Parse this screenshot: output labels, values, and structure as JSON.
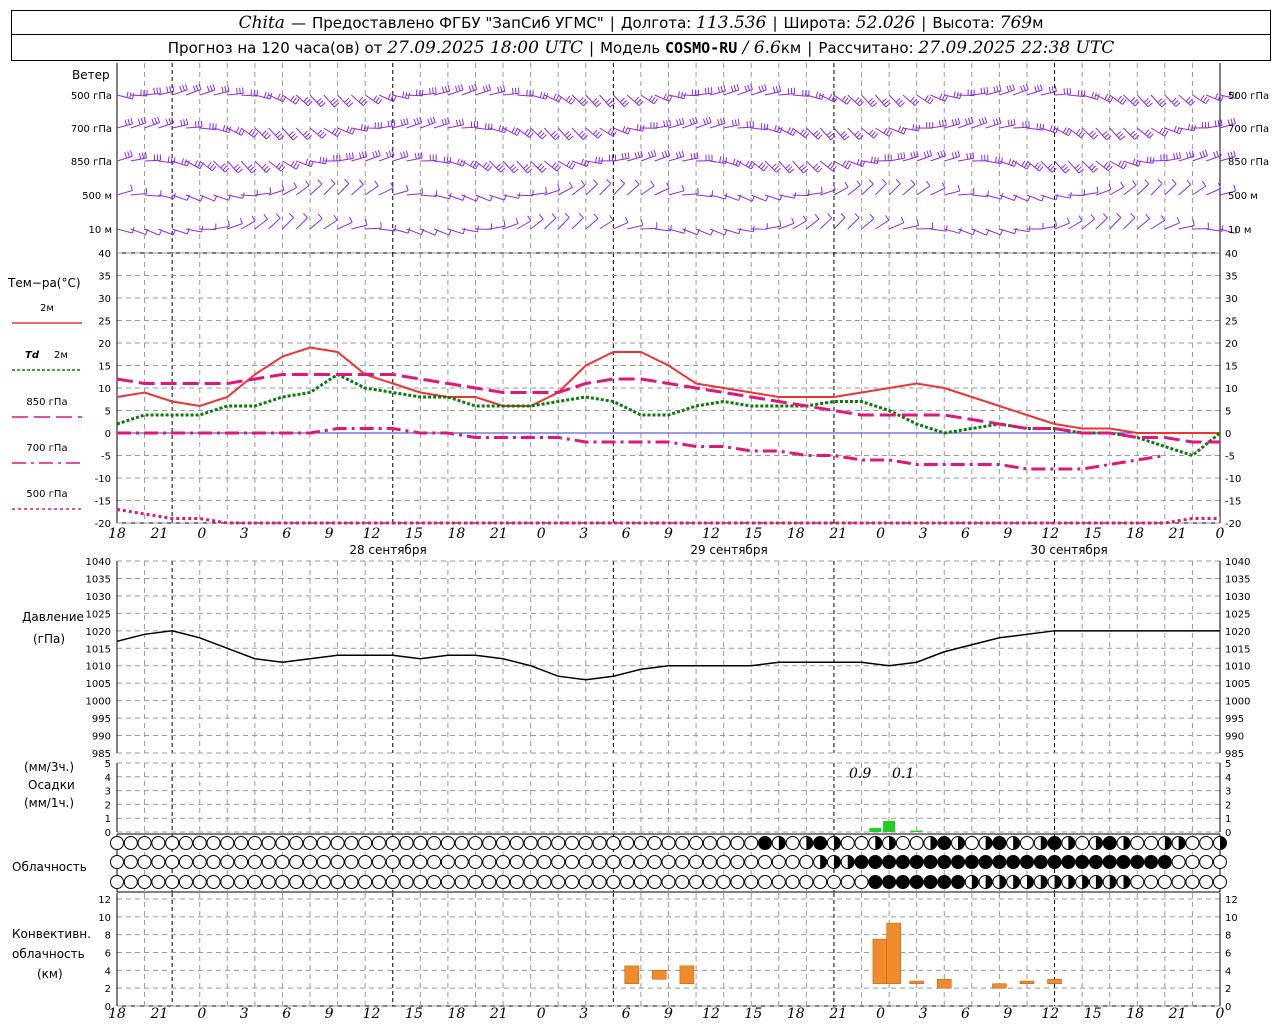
{
  "header": {
    "line1": {
      "station": "Chita",
      "dash": "—",
      "provider": "Предоставлено ФГБУ \"ЗапСиб УГМС\"",
      "lon_label": "Долгота:",
      "lon_value": "113.536",
      "lat_label": "Широта:",
      "lat_value": "52.026",
      "alt_label": "Высота:",
      "alt_value": "769",
      "alt_unit": "м"
    },
    "line2": {
      "forecast_label": "Прогноз на 120 часа(ов) от",
      "forecast_time": "27.09.2025 18:00 UTC",
      "model_label": "Модель",
      "model_name": "COSMO-RU",
      "model_res": "6.6",
      "model_res_unit": "км",
      "calc_label": "Рассчитано:",
      "calc_time": "27.09.2025 22:38 UTC"
    }
  },
  "colors": {
    "wind": "#8a2be2",
    "t2m": "#ee3333",
    "td2m": "#0a7a0a",
    "t850": "#e0167a",
    "t700": "#e0167a",
    "t500": "#e0167a",
    "pressure": "#000000",
    "precip": "#22cc22",
    "convective": "#f08a2a",
    "grid": "#999999"
  },
  "wind_panel": {
    "title": "Ветер",
    "levels": [
      "500 гПа",
      "700 гПа",
      "850 гПа",
      "500 м",
      "10   м"
    ],
    "levels_right": [
      "500 гПа",
      "700 гПа",
      "850 гПа",
      "500 м",
      "10   м"
    ]
  },
  "temp_panel": {
    "title": "Тем−ра(°С)",
    "legend": [
      {
        "label": "2м",
        "key": "t2m"
      },
      {
        "label_td": "Td",
        "label": "2м",
        "key": "td2m"
      },
      {
        "label": "850 гПа",
        "key": "t850"
      },
      {
        "label": "700 гПа",
        "key": "t700"
      },
      {
        "label": "500 гПа",
        "key": "t500"
      }
    ]
  },
  "pressure_panel": {
    "title1": "Давление",
    "title2": "(гПа)"
  },
  "precip_panel": {
    "title_top": "(мм/3ч.)",
    "title_mid": "Осадки",
    "title_bot": "(мм/1ч.)",
    "annotations": [
      "0.9",
      "0.1"
    ]
  },
  "cloud_panel": {
    "title": "Облачность"
  },
  "conv_panel": {
    "title1": "Конвективн.",
    "title2": "облачность",
    "title3": "(км)"
  },
  "x_axis": {
    "hour_labels": [
      "18",
      "21",
      "0",
      "3",
      "6",
      "9",
      "12",
      "15",
      "18",
      "21",
      "0",
      "3",
      "6",
      "9",
      "12",
      "15",
      "18",
      "21",
      "0",
      "3",
      "6",
      "9",
      "12",
      "15",
      "18",
      "21",
      "0"
    ],
    "day_labels": [
      "28 сентября",
      "29 сентября",
      "30 сентября"
    ]
  },
  "chart_data": [
    {
      "type": "line",
      "panel": "temperature",
      "ylim": [
        -20,
        40
      ],
      "yticks": [
        "40",
        "35",
        "30",
        "25",
        "20",
        "15",
        "10",
        "5",
        "0",
        "-5",
        "-10",
        "-15",
        "-20"
      ],
      "x_hours": [
        0,
        3,
        6,
        9,
        12,
        15,
        18,
        21,
        24,
        27,
        30,
        33,
        36,
        39,
        42,
        45,
        48,
        51,
        54,
        57,
        60,
        63,
        66,
        69,
        72,
        75,
        78,
        81,
        84,
        87,
        90,
        93,
        96,
        99,
        102,
        105,
        108,
        111,
        114,
        117,
        120
      ],
      "series": [
        {
          "name": "2м",
          "key": "t2m",
          "values": [
            8,
            9,
            7,
            6,
            8,
            13,
            17,
            19,
            18,
            13,
            11,
            9,
            8,
            8,
            6,
            6,
            9,
            15,
            18,
            18,
            15,
            11,
            10,
            9,
            8,
            8,
            8,
            9,
            10,
            11,
            10,
            8,
            6,
            4,
            2,
            1,
            1,
            0,
            0,
            0,
            0
          ]
        },
        {
          "name": "Td 2м",
          "key": "td2m",
          "values": [
            2,
            4,
            4,
            4,
            6,
            6,
            8,
            9,
            13,
            10,
            9,
            8,
            8,
            6,
            6,
            6,
            7,
            8,
            7,
            4,
            4,
            6,
            7,
            6,
            6,
            6,
            7,
            7,
            5,
            2,
            0,
            1,
            2,
            1,
            1,
            0,
            0,
            -1,
            -3,
            -5,
            0
          ]
        },
        {
          "name": "850 гПа",
          "key": "t850",
          "values": [
            12,
            11,
            11,
            11,
            11,
            12,
            13,
            13,
            13,
            13,
            13,
            12,
            11,
            10,
            9,
            9,
            9,
            11,
            12,
            12,
            11,
            10,
            9,
            8,
            7,
            6,
            5,
            4,
            4,
            4,
            4,
            3,
            2,
            1,
            1,
            0,
            0,
            -1,
            -1,
            -2,
            -2
          ]
        },
        {
          "name": "700 гПа",
          "key": "t700",
          "values": [
            0,
            0,
            0,
            0,
            0,
            0,
            0,
            0,
            1,
            1,
            1,
            0,
            0,
            -1,
            -1,
            -1,
            -1,
            -2,
            -2,
            -2,
            -2,
            -3,
            -3,
            -4,
            -4,
            -5,
            -5,
            -6,
            -6,
            -7,
            -7,
            -7,
            -7,
            -8,
            -8,
            -8,
            -7,
            -6,
            -5
          ]
        },
        {
          "name": "500 гПа",
          "key": "t500",
          "values": [
            -17,
            -18,
            -19,
            -19,
            -20,
            -20,
            -20,
            -20,
            -20,
            -20,
            -20,
            -20,
            -20,
            -20,
            -20,
            -20,
            -20,
            -20,
            -20,
            -20,
            -20,
            -20,
            -20,
            -20,
            -20,
            -20,
            -20,
            -20,
            -20,
            -20,
            -20,
            -20,
            -20,
            -20,
            -20,
            -20,
            -20,
            -20,
            -20,
            -19,
            -19
          ]
        }
      ]
    },
    {
      "type": "line",
      "panel": "pressure",
      "ylim": [
        985,
        1040
      ],
      "yticks": [
        "1040",
        "1035",
        "1030",
        "1025",
        "1020",
        "1015",
        "1010",
        "1005",
        "1000",
        "995",
        "990",
        "985"
      ],
      "x_hours": [
        0,
        3,
        6,
        9,
        12,
        15,
        18,
        21,
        24,
        27,
        30,
        33,
        36,
        39,
        42,
        45,
        48,
        51,
        54,
        57,
        60,
        63,
        66,
        69,
        72,
        75,
        78,
        81,
        84,
        87,
        90,
        93,
        96,
        99,
        102,
        105,
        108,
        111,
        114,
        117,
        120
      ],
      "series": [
        {
          "name": "Давление",
          "key": "pressure",
          "values": [
            1017,
            1019,
            1020,
            1018,
            1015,
            1012,
            1011,
            1012,
            1013,
            1013,
            1013,
            1012,
            1013,
            1013,
            1012,
            1010,
            1007,
            1006,
            1007,
            1009,
            1010,
            1010,
            1010,
            1010,
            1011,
            1011,
            1011,
            1011,
            1010,
            1011,
            1014,
            1016,
            1018,
            1019,
            1020,
            1020,
            1020,
            1020,
            1020,
            1020,
            1020
          ]
        }
      ]
    },
    {
      "type": "bar",
      "panel": "precipitation",
      "ylim": [
        0,
        5
      ],
      "yticks": [
        "5",
        "4",
        "3",
        "2",
        "1",
        "0"
      ],
      "bars": [
        {
          "x_hour": 82.5,
          "value": 0.3
        },
        {
          "x_hour": 84,
          "value": 0.8
        },
        {
          "x_hour": 87,
          "value": 0.1
        }
      ]
    },
    {
      "type": "bar",
      "panel": "convective_cloud",
      "ylim": [
        0,
        13
      ],
      "yticks": [
        "12",
        "10",
        "8",
        "6",
        "4",
        "2",
        "0"
      ],
      "bars": [
        {
          "x_hour": 56,
          "base": 2.5,
          "top": 4.5
        },
        {
          "x_hour": 59,
          "base": 3.0,
          "top": 4.0
        },
        {
          "x_hour": 62,
          "base": 2.5,
          "top": 4.5
        },
        {
          "x_hour": 83,
          "base": 2.5,
          "top": 7.5
        },
        {
          "x_hour": 84.5,
          "base": 2.5,
          "top": 9.3
        },
        {
          "x_hour": 87,
          "base": 2.5,
          "top": 2.8
        },
        {
          "x_hour": 90,
          "base": 2.0,
          "top": 3.0
        },
        {
          "x_hour": 96,
          "base": 2.0,
          "top": 2.5
        },
        {
          "x_hour": 99,
          "base": 2.5,
          "top": 2.8
        },
        {
          "x_hour": 102,
          "base": 2.5,
          "top": 3.0
        }
      ]
    }
  ]
}
